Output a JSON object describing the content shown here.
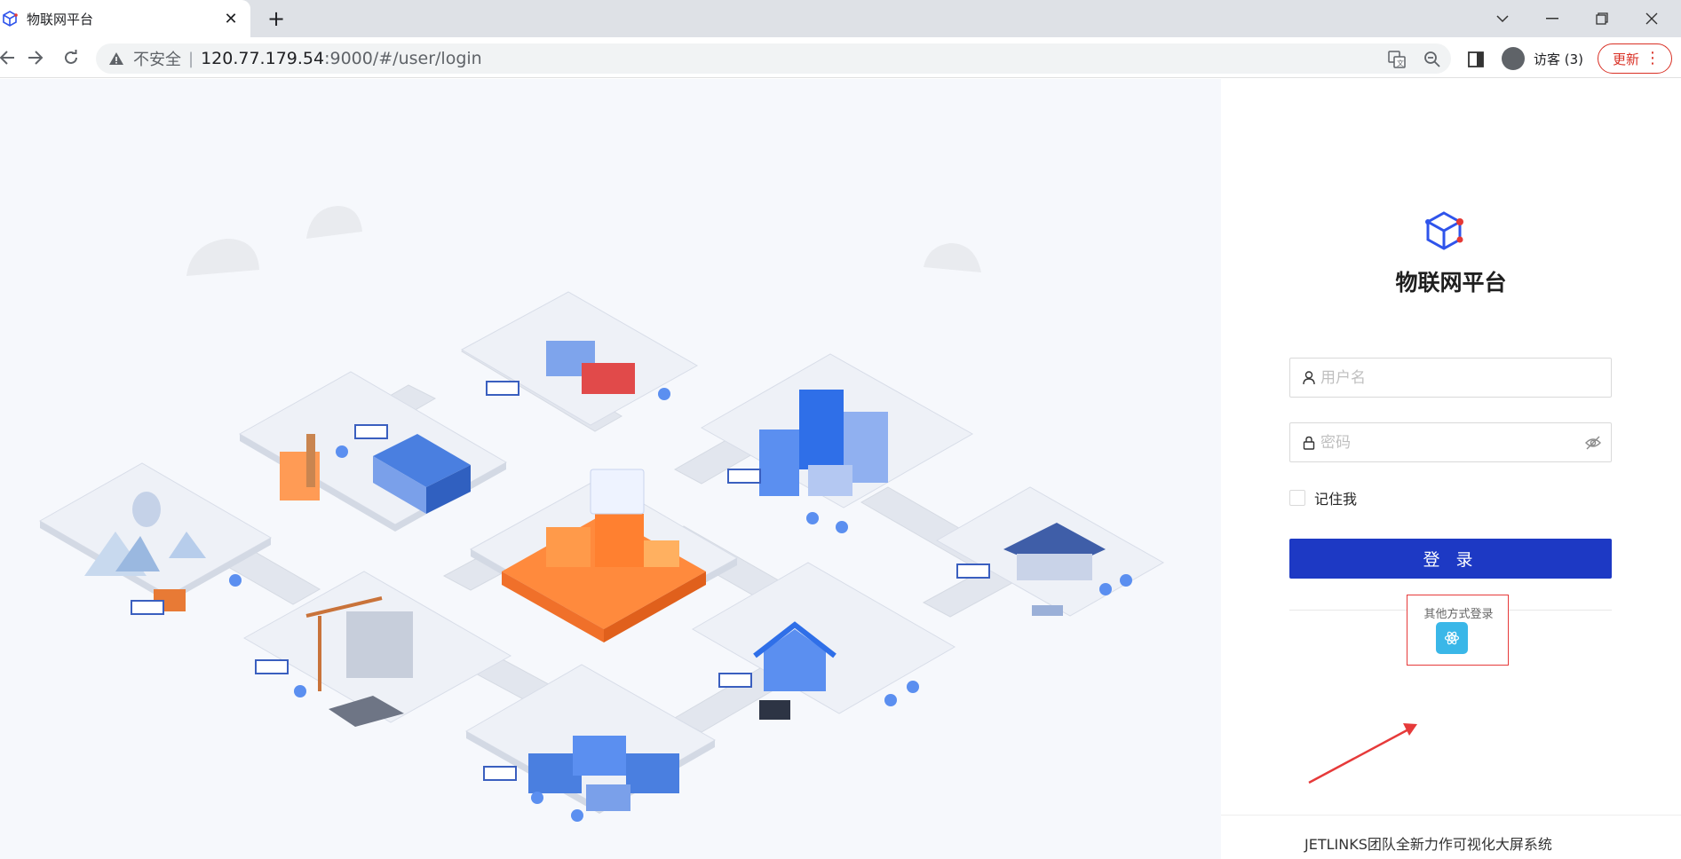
{
  "browser": {
    "tab_title": "物联网平台",
    "security_label": "不安全",
    "url_host": "120.77.179.54",
    "url_rest": ":9000/#/user/login",
    "profile_label": "访客 (3)",
    "update_label": "更新"
  },
  "login": {
    "brand": "物联网平台",
    "username_placeholder": "用户名",
    "password_placeholder": "密码",
    "remember_label": "记住我",
    "login_button": "登 录",
    "other_login_label": "其他方式登录",
    "footer": "JETLINKS团队全新力作可视化大屏系统"
  },
  "colors": {
    "primary": "#1d39c4",
    "sso_icon": "#3ab7e8",
    "annotation": "#e63a3a"
  }
}
